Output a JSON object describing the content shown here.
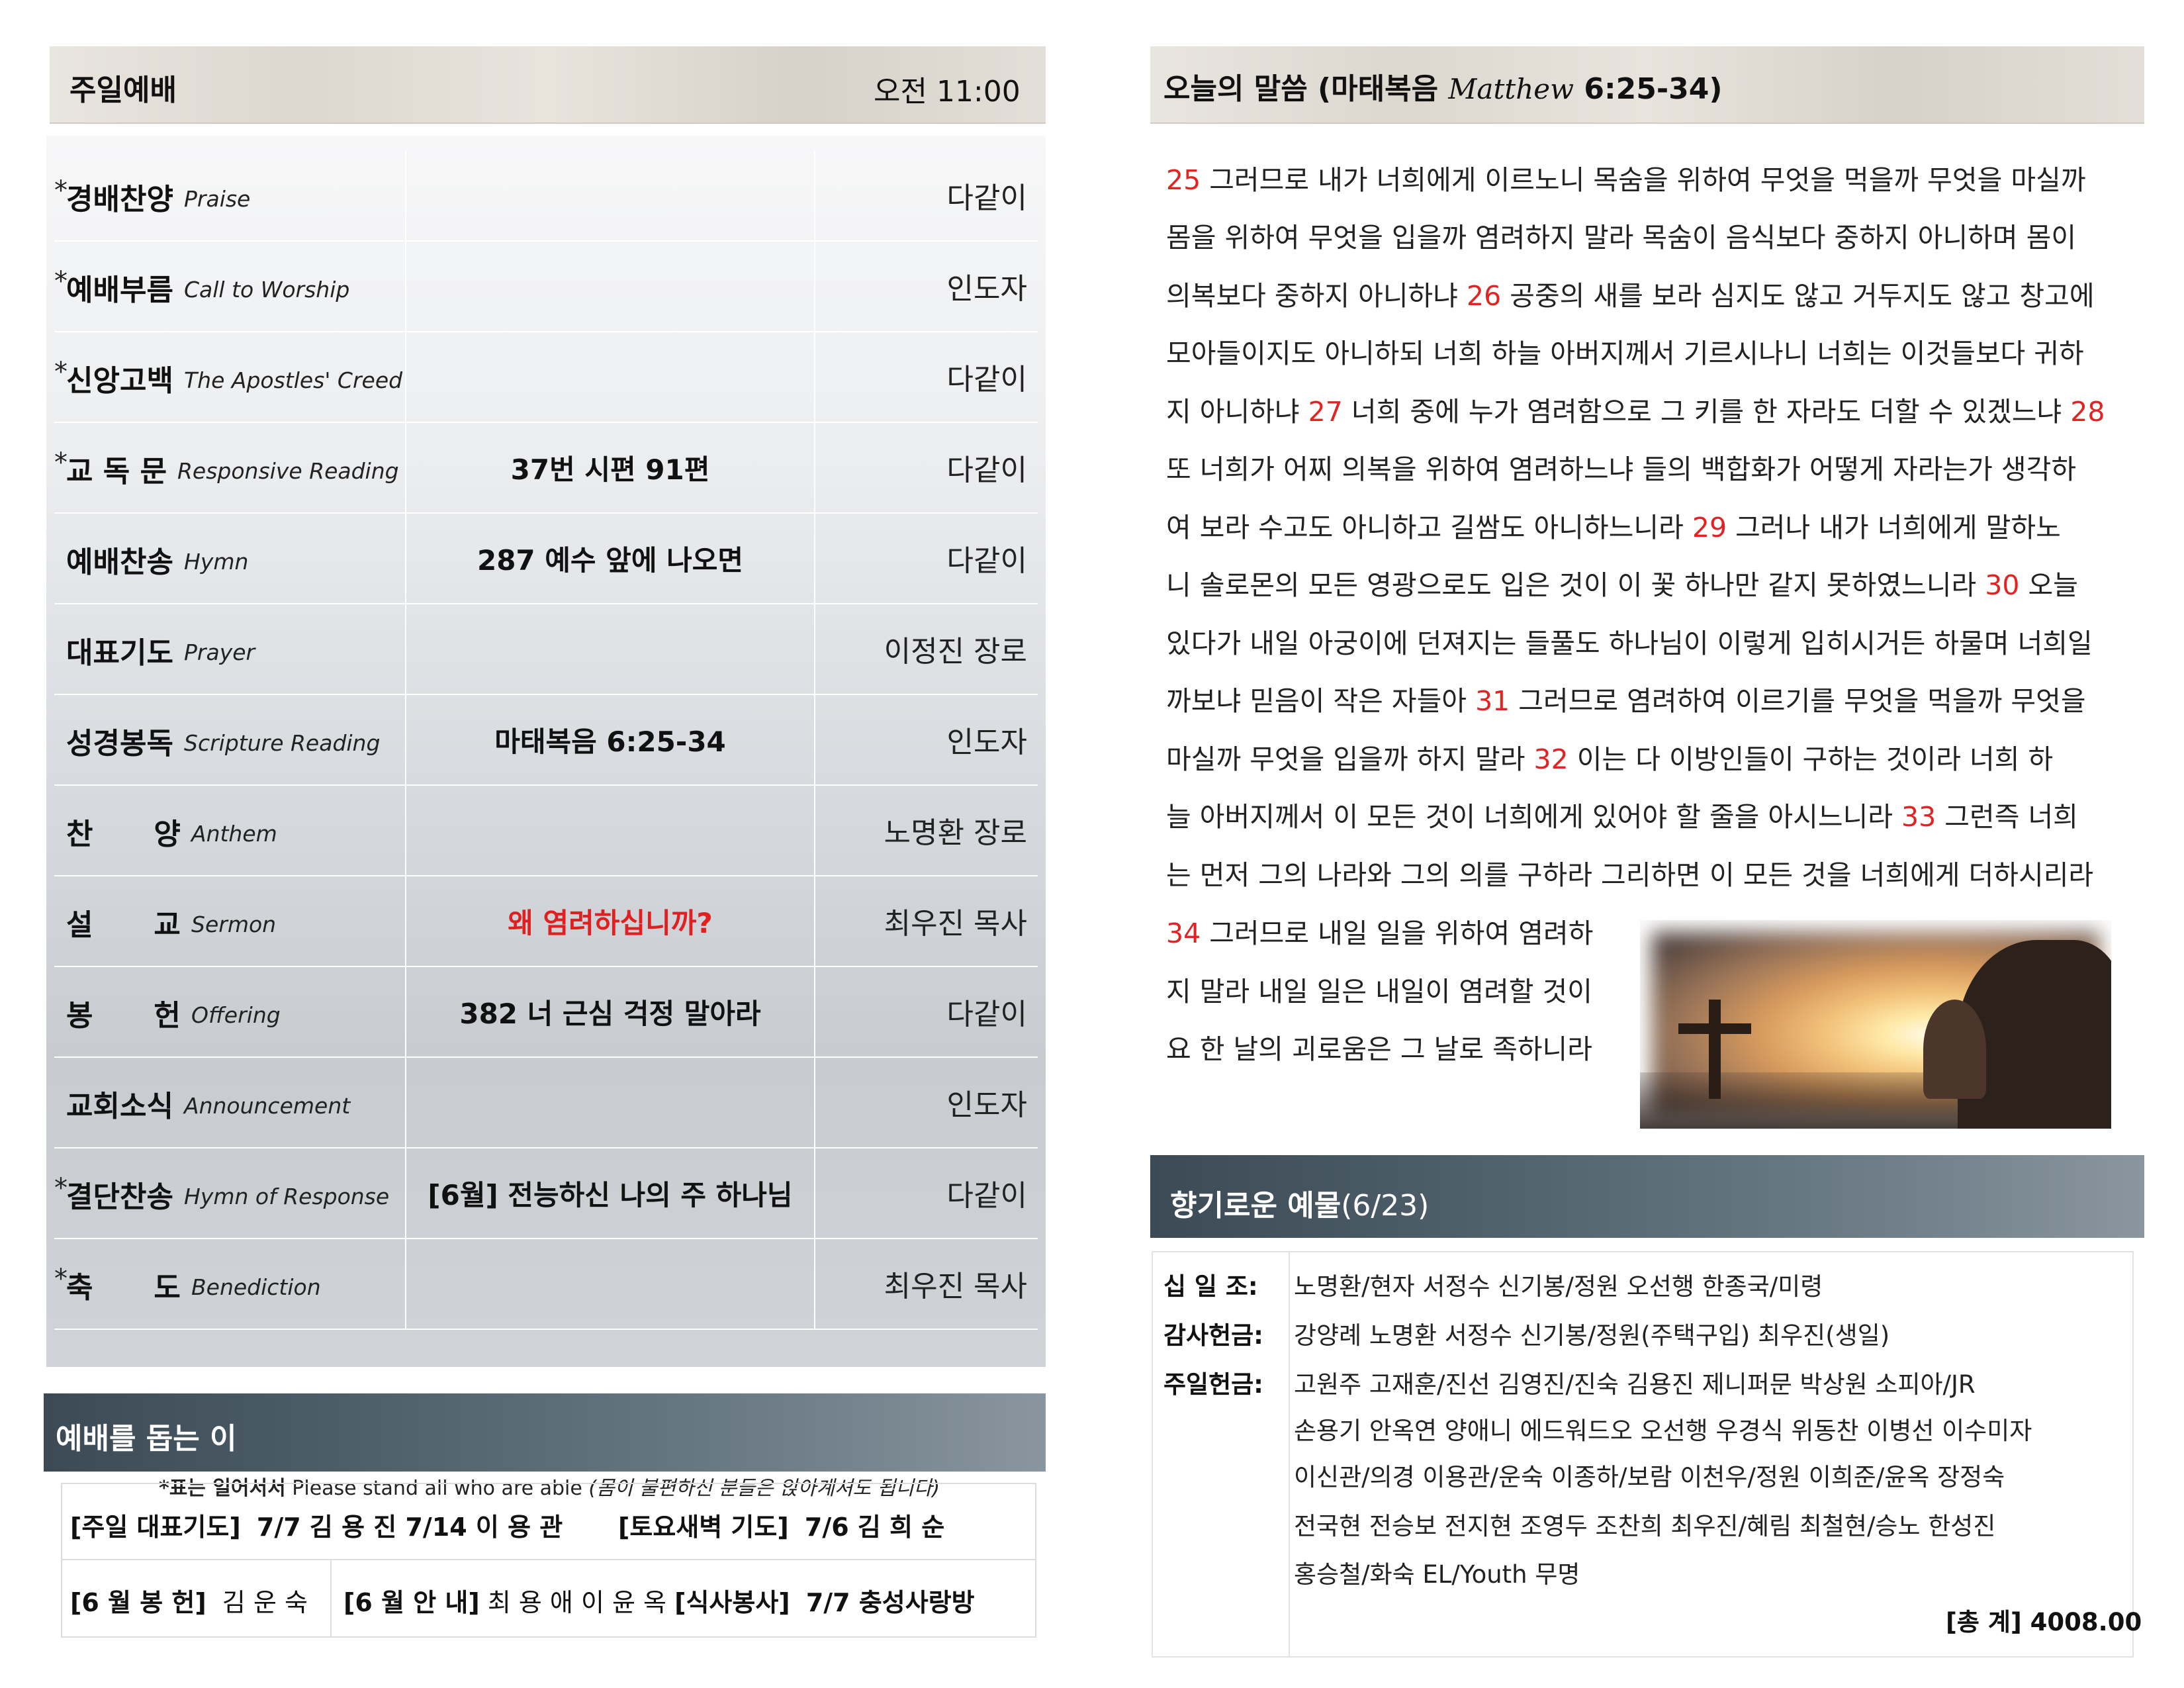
{
  "worship": {
    "title": "주일예배",
    "time": "오전 11:00",
    "items": [
      {
        "star": "*",
        "ko": "경배찬양",
        "en": "Praise",
        "content": "",
        "leader": "다같이"
      },
      {
        "star": "*",
        "ko": "예배부름",
        "en": "Call to Worship",
        "content": "",
        "leader": "인도자"
      },
      {
        "star": "*",
        "ko": "신앙고백",
        "en": "The Apostles' Creed",
        "content": "",
        "leader": "다같이"
      },
      {
        "star": "*",
        "ko": "교 독 문",
        "en": "Responsive Reading",
        "content": "37번 시편 91편",
        "leader": "다같이"
      },
      {
        "star": "",
        "ko": "예배찬송",
        "en": "Hymn",
        "content": "287 예수 앞에 나오면",
        "leader": "다같이"
      },
      {
        "star": "",
        "ko": "대표기도",
        "en": "Prayer",
        "content": "",
        "leader": "이정진 장로"
      },
      {
        "star": "",
        "ko": "성경봉독",
        "en": "Scripture Reading",
        "content": "마태복음 6:25-34",
        "leader": "인도자"
      },
      {
        "star": "",
        "ko": "찬      양",
        "en": "Anthem",
        "content": "",
        "leader": "노명환 장로"
      },
      {
        "star": "",
        "ko": "설      교",
        "en": "Sermon",
        "content": "왜 염려하십니까?",
        "leader": "최우진 목사"
      },
      {
        "star": "",
        "ko": "봉      헌",
        "en": "Offering",
        "content": "382 너 근심 걱정 말아라",
        "leader": "다같이"
      },
      {
        "star": "",
        "ko": "교회소식",
        "en": "Announcement",
        "content": "",
        "leader": "인도자"
      },
      {
        "star": "*",
        "ko": "결단찬송",
        "en": "Hymn of Response",
        "content": "[6월] 전능하신 나의 주 하나님",
        "leader": "다같이"
      },
      {
        "star": "*",
        "ko": "축      도",
        "en": "Benediction",
        "content": "",
        "leader": "최우진 목사"
      }
    ],
    "note_bold": "*표는 일어서서",
    "note_text": " Please stand all who are able ",
    "note_italic": "(몸이 불편하신 분들은 앉아계셔도 됩니다)"
  },
  "helpers": {
    "title": "예배를 돕는 이",
    "row1_a_label": "[주일 대표기도]",
    "row1_a_value": "7/7  김 용 진  7/14 이 용 관",
    "row1_b_label": "[토요새벽 기도]",
    "row1_b_value": "7/6 김 희 순",
    "row2_a_label": "[6 월 봉 헌]",
    "row2_a_value": "김 운 숙",
    "row2_b_label": "[6 월 안 내]",
    "row2_b_value": "최 용 애  이 윤 옥",
    "row2_c_label": "[식사봉사]",
    "row2_c_value": "7/7 충성사랑방"
  },
  "scripture": {
    "title_ko": "오늘의 말씀 (마태복음",
    "title_en": "Matthew",
    "title_ref": "6:25-34)",
    "lines": [
      [
        {
          "v": "25"
        },
        {
          "t": " 그러므로 내가 너희에게 이르노니 목숨을 위하여 무엇을 먹을까 무엇을 마실까"
        }
      ],
      [
        {
          "t": "몸을 위하여 무엇을 입을까 염려하지 말라 목숨이 음식보다 중하지 아니하며 몸이"
        }
      ],
      [
        {
          "t": "의복보다 중하지 아니하냐 "
        },
        {
          "v": "26"
        },
        {
          "t": " 공중의 새를 보라 심지도 않고 거두지도 않고 창고에"
        }
      ],
      [
        {
          "t": "모아들이지도 아니하되 너희 하늘 아버지께서 기르시나니 너희는 이것들보다 귀하"
        }
      ],
      [
        {
          "t": "지 아니하냐 "
        },
        {
          "v": "27"
        },
        {
          "t": " 너희 중에 누가 염려함으로 그 키를 한 자라도 더할 수 있겠느냐 "
        },
        {
          "v": "28"
        }
      ],
      [
        {
          "t": "또 너희가 어찌 의복을 위하여 염려하느냐 들의 백합화가 어떻게 자라는가 생각하"
        }
      ],
      [
        {
          "t": "여 보라 수고도 아니하고 길쌈도 아니하느니라 "
        },
        {
          "v": "29"
        },
        {
          "t": " 그러나 내가 너희에게 말하노"
        }
      ],
      [
        {
          "t": "니 솔로몬의 모든 영광으로도 입은 것이 이 꽃 하나만 같지 못하였느니라 "
        },
        {
          "v": "30"
        },
        {
          "t": " 오늘"
        }
      ],
      [
        {
          "t": "있다가 내일 아궁이에 던져지는 들풀도 하나님이 이렇게 입히시거든 하물며 너희일"
        }
      ],
      [
        {
          "t": "까보냐 믿음이 작은 자들아 "
        },
        {
          "v": "31"
        },
        {
          "t": " 그러므로 염려하여 이르기를 무엇을 먹을까 무엇을"
        }
      ],
      [
        {
          "t": "마실까 무엇을 입을까 하지 말라 "
        },
        {
          "v": "32"
        },
        {
          "t": " 이는 다 이방인들이 구하는 것이라 너희 하"
        }
      ],
      [
        {
          "t": "늘 아버지께서 이 모든 것이 너희에게 있어야 할 줄을 아시느니라 "
        },
        {
          "v": "33"
        },
        {
          "t": " 그런즉 너희"
        }
      ],
      [
        {
          "t": "는 먼저 그의 나라와 그의 의를 구하라 그리하면 이 모든 것을 너희에게 더하시리라"
        }
      ],
      [
        {
          "v": "34"
        },
        {
          "t": " 그러므로 내일 일을 위하여 염려하"
        }
      ],
      [
        {
          "t": "지 말라 내일 일은 내일이 염려할 것이"
        }
      ],
      [
        {
          "t": "요 한 날의 괴로움은 그 날로 족하니라"
        }
      ]
    ]
  },
  "offerings": {
    "title_bold": "향기로운 예물",
    "title_date": "(6/23)",
    "tithe_label": "십 일 조:",
    "tithe": "노명환/현자 서정수 신기봉/정원 오선행 한종국/미령",
    "thanks_label": "감사헌금:",
    "thanks": "강양례 노명환 서정수 신기봉/정원(주택구입) 최우진(생일)",
    "sunday_label": "주일헌금:",
    "sunday_lines": [
      "고원주 고재훈/진선 김영진/진숙 김용진 제니퍼문 박상원 소피아/JR",
      "손용기 안옥연 양애니 에드워드오 오선행 우경식 위동찬 이병선 이수미자",
      "이신관/의경 이용관/운숙 이종하/보람 이천우/정원 이희준/윤옥 장정숙",
      "전국현 전승보 전지현 조영두 조찬희 최우진/혜림 최철현/승노 한성진",
      "홍승철/화숙 EL/Youth 무명"
    ],
    "total": "[총 계] 4008.00"
  },
  "colors": {
    "verse_number": "#e32222",
    "sermon_title": "#e02020",
    "slate_bar": "#4d5e69"
  }
}
